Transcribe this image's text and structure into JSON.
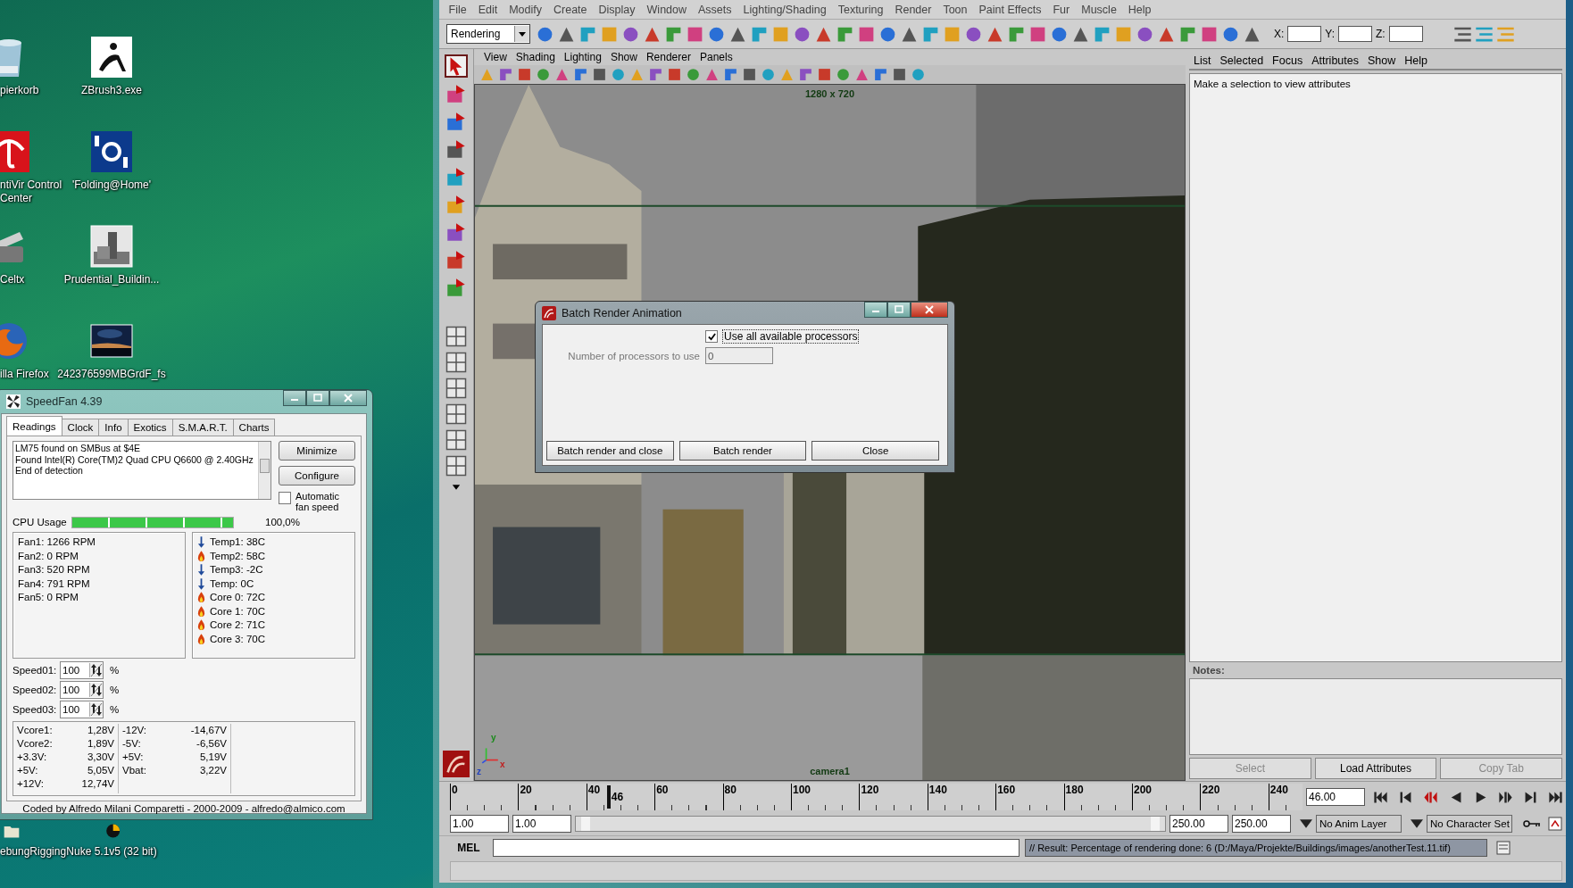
{
  "desktop": {
    "icons": [
      {
        "label": "pierkorb",
        "kind": "trash"
      },
      {
        "label": "ZBrush3.exe",
        "kind": "figure"
      },
      {
        "label": "ntiVir Control Center",
        "kind": "umbrella"
      },
      {
        "label": "'Folding@Home'",
        "kind": "badge"
      },
      {
        "label": "Celtx",
        "kind": "clapper"
      },
      {
        "label": "Prudential_Buildin..."
      },
      {
        "label": "illa Firefox",
        "kind": "globe"
      },
      {
        "label": "242376599MBGrdF_fs",
        "kind": "nightphoto"
      },
      {
        "label": "ebungRigging",
        "kind": "folder"
      },
      {
        "label": "Nuke 5.1v5 (32 bit)",
        "kind": "disc"
      }
    ]
  },
  "speedfan": {
    "title": "SpeedFan 4.39",
    "tabs": [
      {
        "label": "Readings",
        "selected": true
      },
      {
        "label": "Clock",
        "selected": false
      },
      {
        "label": "Info",
        "selected": false
      },
      {
        "label": "Exotics",
        "selected": false
      },
      {
        "label": "S.M.A.R.T.",
        "selected": false
      },
      {
        "label": "Charts",
        "selected": false
      }
    ],
    "log": [
      "LM75 found on SMBus at $4E",
      "Found Intel(R) Core(TM)2 Quad CPU Q6600 @ 2.40GHz",
      "End of detection"
    ],
    "buttons": [
      "Minimize",
      "Configure"
    ],
    "auto_fan": {
      "label": "Automatic fan speed",
      "checked": false
    },
    "cpu": {
      "label": "CPU Usage",
      "level": 1,
      "reading": "100,0%"
    },
    "fans": [
      "Fan1: 1266 RPM",
      "Fan2: 0 RPM",
      "Fan3: 520 RPM",
      "Fan4: 791 RPM",
      "Fan5: 0 RPM"
    ],
    "temps": [
      {
        "text": "Temp1: 38C",
        "kind": "ok"
      },
      {
        "text": "Temp2: 58C",
        "kind": "hot"
      },
      {
        "text": "Temp3: -2C",
        "kind": "ok"
      },
      {
        "text": "Temp: 0C",
        "kind": "ok"
      },
      {
        "text": "Core 0: 72C",
        "kind": "hot"
      },
      {
        "text": "Core 1: 70C",
        "kind": "hot"
      },
      {
        "text": "Core 2: 71C",
        "kind": "hot"
      },
      {
        "text": "Core 3: 70C",
        "kind": "hot"
      }
    ],
    "speeds": [
      {
        "label": "Speed01:",
        "value": "100",
        "unit": "%"
      },
      {
        "label": "Speed02:",
        "value": "100",
        "unit": "%"
      },
      {
        "label": "Speed03:",
        "value": "100",
        "unit": "%"
      }
    ],
    "voltages": [
      [
        {
          "name": "Vcore1:",
          "value": "1,28V"
        },
        {
          "name": "Vcore2:",
          "value": "1,89V"
        },
        {
          "name": "+3.3V:",
          "value": "3,30V"
        },
        {
          "name": "+5V:",
          "value": "5,05V"
        },
        {
          "name": "+12V:",
          "value": "12,74V"
        }
      ],
      [
        {
          "name": "-12V:",
          "value": "-14,67V"
        },
        {
          "name": "-5V:",
          "value": "-6,56V"
        },
        {
          "name": "+5V:",
          "value": "5,19V"
        },
        {
          "name": "Vbat:",
          "value": "3,22V"
        }
      ]
    ],
    "footer": "Coded by Alfredo Milani Comparetti - 2000-2009 - alfredo@almico.com"
  },
  "maya": {
    "menu": [
      "File",
      "Edit",
      "Modify",
      "Create",
      "Display",
      "Window",
      "Assets",
      "Lighting/Shading",
      "Texturing",
      "Render",
      "Toon",
      "Paint Effects",
      "Fur",
      "Muscle",
      "Help"
    ],
    "menu_set": "Rendering",
    "coordinates": [
      "X:",
      "Y:",
      "Z:"
    ],
    "viewport": {
      "menu": [
        "View",
        "Shading",
        "Lighting",
        "Show",
        "Renderer",
        "Panels"
      ],
      "resolution": "1280 x 720",
      "camera": "camera1",
      "axes": [
        "y",
        "z",
        "x"
      ]
    },
    "attribute_editor": {
      "menu": [
        "List",
        "Selected",
        "Focus",
        "Attributes",
        "Show",
        "Help"
      ],
      "message": "Make a selection to view attributes",
      "notes_label": "Notes:",
      "buttons": [
        {
          "label": "Select",
          "disabled": true
        },
        {
          "label": "Load Attributes",
          "disabled": false
        },
        {
          "label": "Copy Tab",
          "disabled": true
        }
      ]
    },
    "timeline": {
      "ticks": [
        "0",
        "20",
        "40",
        "60",
        "80",
        "100",
        "120",
        "140",
        "160",
        "180",
        "200",
        "220",
        "240"
      ],
      "level": 0.184,
      "marker": "46",
      "current_frame": "46.00"
    },
    "range": {
      "fields": [
        "1.00",
        "1.00",
        "250.00",
        "250.00"
      ],
      "anim_layer": "No Anim Layer",
      "character_set": "No Character Set"
    },
    "command_line": {
      "label": "MEL",
      "result": "// Result: Percentage of rendering done: 6 (D:/Maya/Projekte/Buildings/images/anotherTest.11.tif)"
    }
  },
  "dialog": {
    "title": "Batch Render Animation",
    "use_all": {
      "label": "Use all available processors",
      "checked": true
    },
    "processors": {
      "label": "Number of processors to use",
      "value": "0",
      "disabled": true
    },
    "buttons": [
      "Batch render and close",
      "Batch render",
      "Close"
    ]
  }
}
